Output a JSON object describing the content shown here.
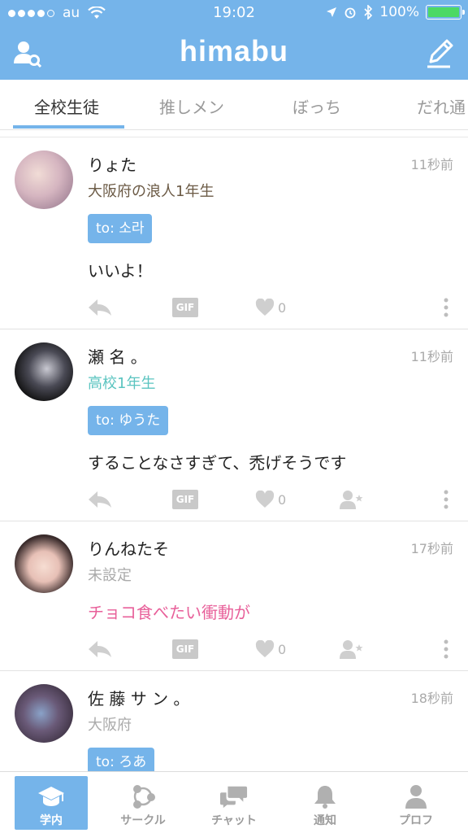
{
  "status": {
    "carrier": "au",
    "time": "19:02",
    "battery": "100%"
  },
  "header": {
    "title": "himabu",
    "left_icon": "user-search-icon",
    "right_icon": "compose-icon"
  },
  "tabs": [
    {
      "label": "全校生徒",
      "active": true
    },
    {
      "label": "推しメン",
      "active": false
    },
    {
      "label": "ぼっち",
      "active": false
    },
    {
      "label": "だれ通",
      "active": false
    }
  ],
  "posts": [
    {
      "name": "りょた",
      "time": "11秒前",
      "school": "大阪府の浪人1年生",
      "school_color": "#6b5a45",
      "to": "to: 소라",
      "message": "いいよ！",
      "message_color": "#222222",
      "likes": "0"
    },
    {
      "name": "瀬 名 。",
      "time": "11秒前",
      "school": "高校1年生",
      "school_color": "#5bc4c0",
      "to": "to: ゆうた",
      "message": "することなさすぎて、禿げそうです",
      "message_color": "#222222",
      "likes": "0"
    },
    {
      "name": "りんねたそ",
      "time": "17秒前",
      "school": "未設定",
      "school_color": "#aaaaaa",
      "to": "",
      "message": "チョコ食べたい衝動が",
      "message_color": "#e8609a",
      "likes": "0"
    },
    {
      "name": "佐 藤 サ ン 。",
      "time": "18秒前",
      "school": "大阪府",
      "school_color": "#aaaaaa",
      "to": "to: ろあ",
      "message": "",
      "message_color": "#222222",
      "likes": ""
    }
  ],
  "actions": {
    "gif_label": "GIF"
  },
  "nav": [
    {
      "label": "学内",
      "icon": "graduation-cap-icon",
      "active": true
    },
    {
      "label": "サークル",
      "icon": "circle-network-icon",
      "active": false
    },
    {
      "label": "チャット",
      "icon": "chat-bubbles-icon",
      "active": false
    },
    {
      "label": "通知",
      "icon": "bell-icon",
      "active": false
    },
    {
      "label": "プロフ",
      "icon": "profile-icon",
      "active": false
    }
  ],
  "colors": {
    "accent": "#75b4ea",
    "battery": "#4cd964",
    "divider": "#e2e2e2"
  }
}
